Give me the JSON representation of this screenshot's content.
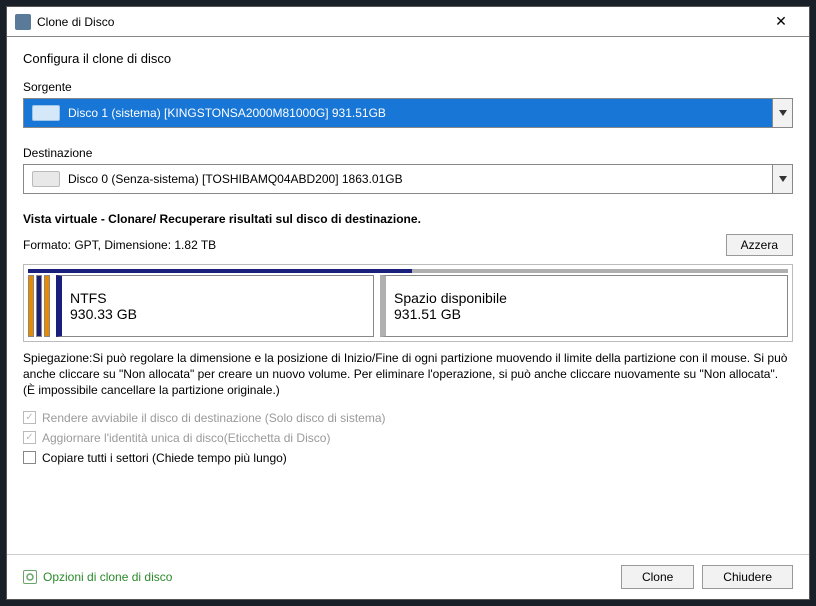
{
  "title": "Clone di Disco",
  "subtitle": "Configura il clone di disco",
  "source": {
    "label": "Sorgente",
    "text": "Disco 1 (sistema) [KINGSTONSA2000M81000G]   931.51GB"
  },
  "dest": {
    "label": "Destinazione",
    "text": "Disco 0 (Senza-sistema) [TOSHIBAMQ04ABD200]   1863.01GB"
  },
  "virtual_title": "Vista virtuale - Clonare/ Recuperare risultati sul disco di destinazione.",
  "format_text": "Formato: GPT,  Dimensione: 1.82 TB",
  "reset_btn": "Azzera",
  "partitions": {
    "ntfs_label": "NTFS",
    "ntfs_size": "930.33 GB",
    "free_label": "Spazio disponibile",
    "free_size": "931.51 GB"
  },
  "explain": "Spiegazione:Si può regolare la dimensione e la posizione di Inizio/Fine di ogni partizione muovendo il limite della partizione con il mouse. Si può anche cliccare su \"Non allocata\" per creare un nuovo volume. Per eliminare l'operazione, si può anche cliccare nuovamente su \"Non allocata\". (È impossibile cancellare la partizione originale.)",
  "checks": {
    "bootable": "Rendere avviabile il disco di destinazione (Solo disco di sistema)",
    "update_id": "Aggiornare l'identità unica di disco(Eticchetta di Disco)",
    "copy_all": "Copiare tutti i settori (Chiede tempo più lungo)"
  },
  "footer": {
    "options": "Opzioni di clone di disco",
    "clone": "Clone",
    "close": "Chiudere"
  }
}
